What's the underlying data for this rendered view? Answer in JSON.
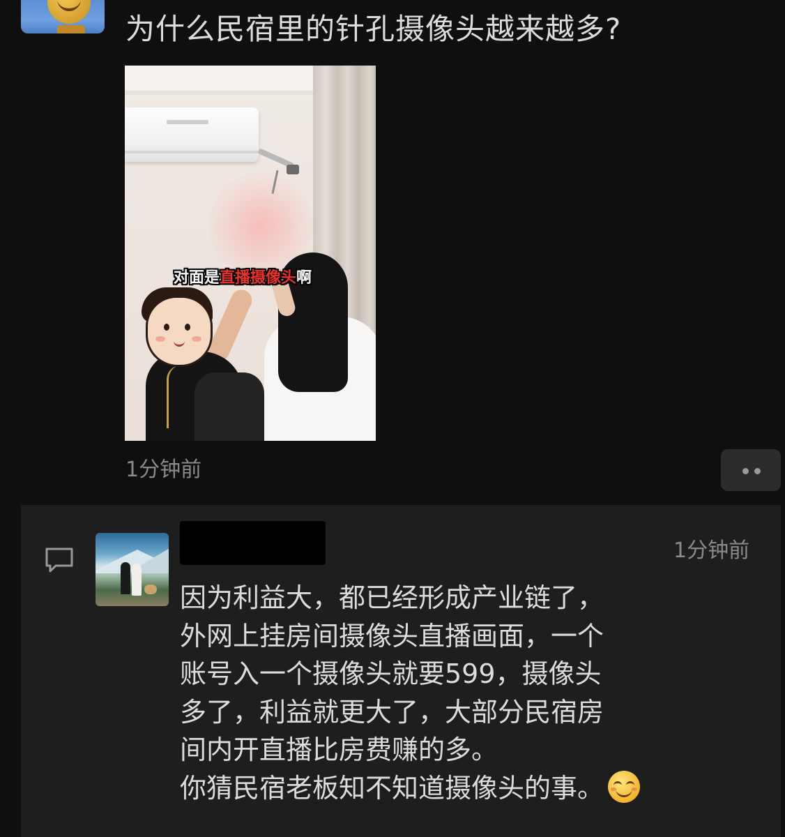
{
  "post": {
    "title": "为什么民宿里的针孔摄像头越来越多?",
    "time": "1分钟前",
    "image": {
      "caption_prefix": "对面是",
      "caption_highlight": "直播摄像头",
      "caption_suffix": "啊"
    },
    "more_icon": "ellipsis-icon"
  },
  "comment": {
    "icon": "speech-bubble-icon",
    "time": "1分钟前",
    "lines": [
      "因为利益大，都已经形成产业链了，",
      "外网上挂房间摄像头直播画面，一个",
      "账号入一个摄像头就要599，摄像头",
      "多了，利益就更大了，大部分民宿房",
      "间内开直播比房费赚的多。",
      "你猜民宿老板知不知道摄像头的事。"
    ],
    "emoji": "grinning-smile-emoji"
  }
}
